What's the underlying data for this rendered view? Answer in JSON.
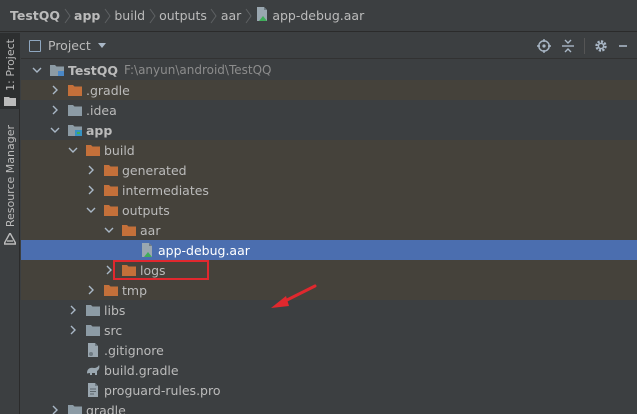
{
  "breadcrumb": {
    "items": [
      {
        "label": "TestQQ",
        "bold": true
      },
      {
        "label": "app",
        "bold": true
      },
      {
        "label": "build",
        "bold": false
      },
      {
        "label": "outputs",
        "bold": false
      },
      {
        "label": "aar",
        "bold": false
      },
      {
        "label": "app-debug.aar",
        "bold": false,
        "icon": "aar-file-icon"
      }
    ]
  },
  "sidebar": {
    "project_tab": "1: Project",
    "resource_tab": "Resource Manager"
  },
  "panel": {
    "title": "Project",
    "icons": [
      "locate-icon",
      "collapse-all-icon",
      "gear-icon",
      "hide-icon"
    ]
  },
  "tree": {
    "root": {
      "label": "TestQQ",
      "path": "F:\\anyun\\android\\TestQQ"
    },
    "rows": [
      {
        "label": "TestQQ",
        "depth": 0,
        "expanded": true,
        "icon": "module-icon",
        "excluded": false
      },
      {
        "label": ".gradle",
        "depth": 1,
        "expanded": false,
        "icon": "folder-orange-icon",
        "excluded": true
      },
      {
        "label": ".idea",
        "depth": 1,
        "expanded": false,
        "icon": "folder-gray-icon",
        "excluded": false
      },
      {
        "label": "app",
        "depth": 1,
        "expanded": true,
        "icon": "android-module-icon",
        "excluded": false
      },
      {
        "label": "build",
        "depth": 2,
        "expanded": true,
        "icon": "folder-orange-icon",
        "excluded": true
      },
      {
        "label": "generated",
        "depth": 3,
        "expanded": false,
        "icon": "folder-orange-icon",
        "excluded": true
      },
      {
        "label": "intermediates",
        "depth": 3,
        "expanded": false,
        "icon": "folder-orange-icon",
        "excluded": true
      },
      {
        "label": "outputs",
        "depth": 3,
        "expanded": true,
        "icon": "folder-orange-icon",
        "excluded": true
      },
      {
        "label": "aar",
        "depth": 4,
        "expanded": true,
        "icon": "folder-orange-icon",
        "excluded": true
      },
      {
        "label": "app-debug.aar",
        "depth": 5,
        "expanded": null,
        "icon": "aar-file-icon",
        "excluded": false,
        "selected": true
      },
      {
        "label": "logs",
        "depth": 4,
        "expanded": false,
        "icon": "folder-orange-icon",
        "excluded": true
      },
      {
        "label": "tmp",
        "depth": 3,
        "expanded": false,
        "icon": "folder-orange-icon",
        "excluded": true
      },
      {
        "label": "libs",
        "depth": 2,
        "expanded": false,
        "icon": "folder-gray-icon",
        "excluded": false
      },
      {
        "label": "src",
        "depth": 2,
        "expanded": false,
        "icon": "folder-gray-icon",
        "excluded": false
      },
      {
        "label": ".gitignore",
        "depth": 2,
        "expanded": null,
        "icon": "gitignore-file-icon",
        "excluded": false
      },
      {
        "label": "build.gradle",
        "depth": 2,
        "expanded": null,
        "icon": "gradle-file-icon",
        "excluded": false
      },
      {
        "label": "proguard-rules.pro",
        "depth": 2,
        "expanded": null,
        "icon": "text-file-icon",
        "excluded": false
      },
      {
        "label": "gradle",
        "depth": 1,
        "expanded": false,
        "icon": "folder-gray-icon",
        "excluded": false
      }
    ]
  },
  "colors": {
    "background": "#3c3f41",
    "excluded_row": "#45423b",
    "selection": "#4b6eaf",
    "folder_orange": "#c4703a",
    "folder_gray": "#8c9ba5",
    "annotation_red": "#e0282e"
  }
}
